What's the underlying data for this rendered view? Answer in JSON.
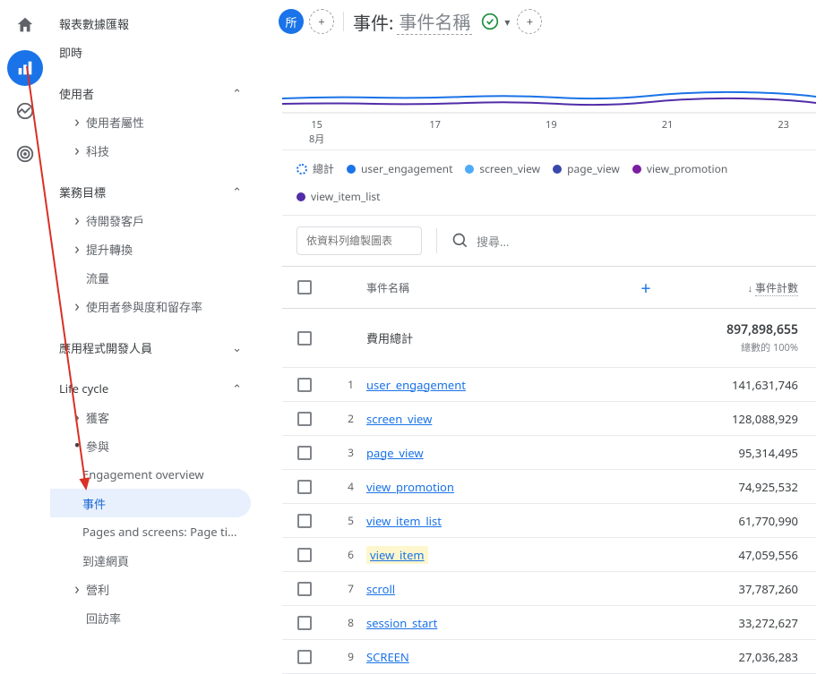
{
  "header": {
    "scope_badge": "所",
    "title_prefix": "事件:",
    "title_value": "事件名稱"
  },
  "sidebar": {
    "items": [
      {
        "label": "報表數據匯報",
        "type": "h0"
      },
      {
        "label": "即時",
        "type": "h0"
      },
      {
        "label": "使用者",
        "type": "section",
        "expanded": true
      },
      {
        "label": "使用者屬性",
        "type": "subsection"
      },
      {
        "label": "科技",
        "type": "subsection"
      },
      {
        "label": "業務目標",
        "type": "section",
        "expanded": true
      },
      {
        "label": "待開發客戶",
        "type": "subsection"
      },
      {
        "label": "提升轉換",
        "type": "subsection"
      },
      {
        "label": "流量",
        "type": "leaf"
      },
      {
        "label": "使用者參與度和留存率",
        "type": "subsection"
      },
      {
        "label": "應用程式開發人員",
        "type": "section",
        "expanded": false
      },
      {
        "label": "Life cycle",
        "type": "section",
        "expanded": true
      },
      {
        "label": "獲客",
        "type": "subsection"
      },
      {
        "label": "參與",
        "type": "subsection-open"
      },
      {
        "label": "Engagement overview",
        "type": "leaf2"
      },
      {
        "label": "事件",
        "type": "leaf2-active"
      },
      {
        "label": "Pages and screens: Page ti...",
        "type": "leaf2"
      },
      {
        "label": "到達網頁",
        "type": "leaf2"
      },
      {
        "label": "營利",
        "type": "subsection"
      },
      {
        "label": "回訪率",
        "type": "leaf"
      }
    ]
  },
  "chart": {
    "xticks": [
      {
        "t1": "15",
        "t2": "8月"
      },
      {
        "t1": "17",
        "t2": ""
      },
      {
        "t1": "19",
        "t2": ""
      },
      {
        "t1": "21",
        "t2": ""
      },
      {
        "t1": "23",
        "t2": ""
      }
    ]
  },
  "legend": {
    "total": "總計",
    "items": [
      {
        "label": "user_engagement",
        "color": "#1a73e8"
      },
      {
        "label": "screen_view",
        "color": "#4dabf7"
      },
      {
        "label": "page_view",
        "color": "#3949ab"
      },
      {
        "label": "view_promotion",
        "color": "#7b1fa2"
      },
      {
        "label": "view_item_list",
        "color": "#512da8"
      }
    ]
  },
  "toolbar": {
    "filter_placeholder": "依資料列繪製圖表",
    "search_placeholder": "搜尋..."
  },
  "table": {
    "headers": {
      "name": "事件名稱",
      "count": "事件計數"
    },
    "total": {
      "label": "費用總計",
      "value": "897,898,655",
      "sub": "總數的 100%"
    },
    "rows": [
      {
        "idx": "1",
        "name": "user_engagement",
        "count": "141,631,746"
      },
      {
        "idx": "2",
        "name": "screen_view",
        "count": "128,088,929"
      },
      {
        "idx": "3",
        "name": "page_view",
        "count": "95,314,495"
      },
      {
        "idx": "4",
        "name": "view_promotion",
        "count": "74,925,532"
      },
      {
        "idx": "5",
        "name": "view_item_list",
        "count": "61,770,990"
      },
      {
        "idx": "6",
        "name": "view_item",
        "count": "47,059,556",
        "hl": true
      },
      {
        "idx": "7",
        "name": "scroll",
        "count": "37,787,260"
      },
      {
        "idx": "8",
        "name": "session_start",
        "count": "33,272,627"
      },
      {
        "idx": "9",
        "name": "SCREEN",
        "count": "27,036,283"
      }
    ]
  }
}
